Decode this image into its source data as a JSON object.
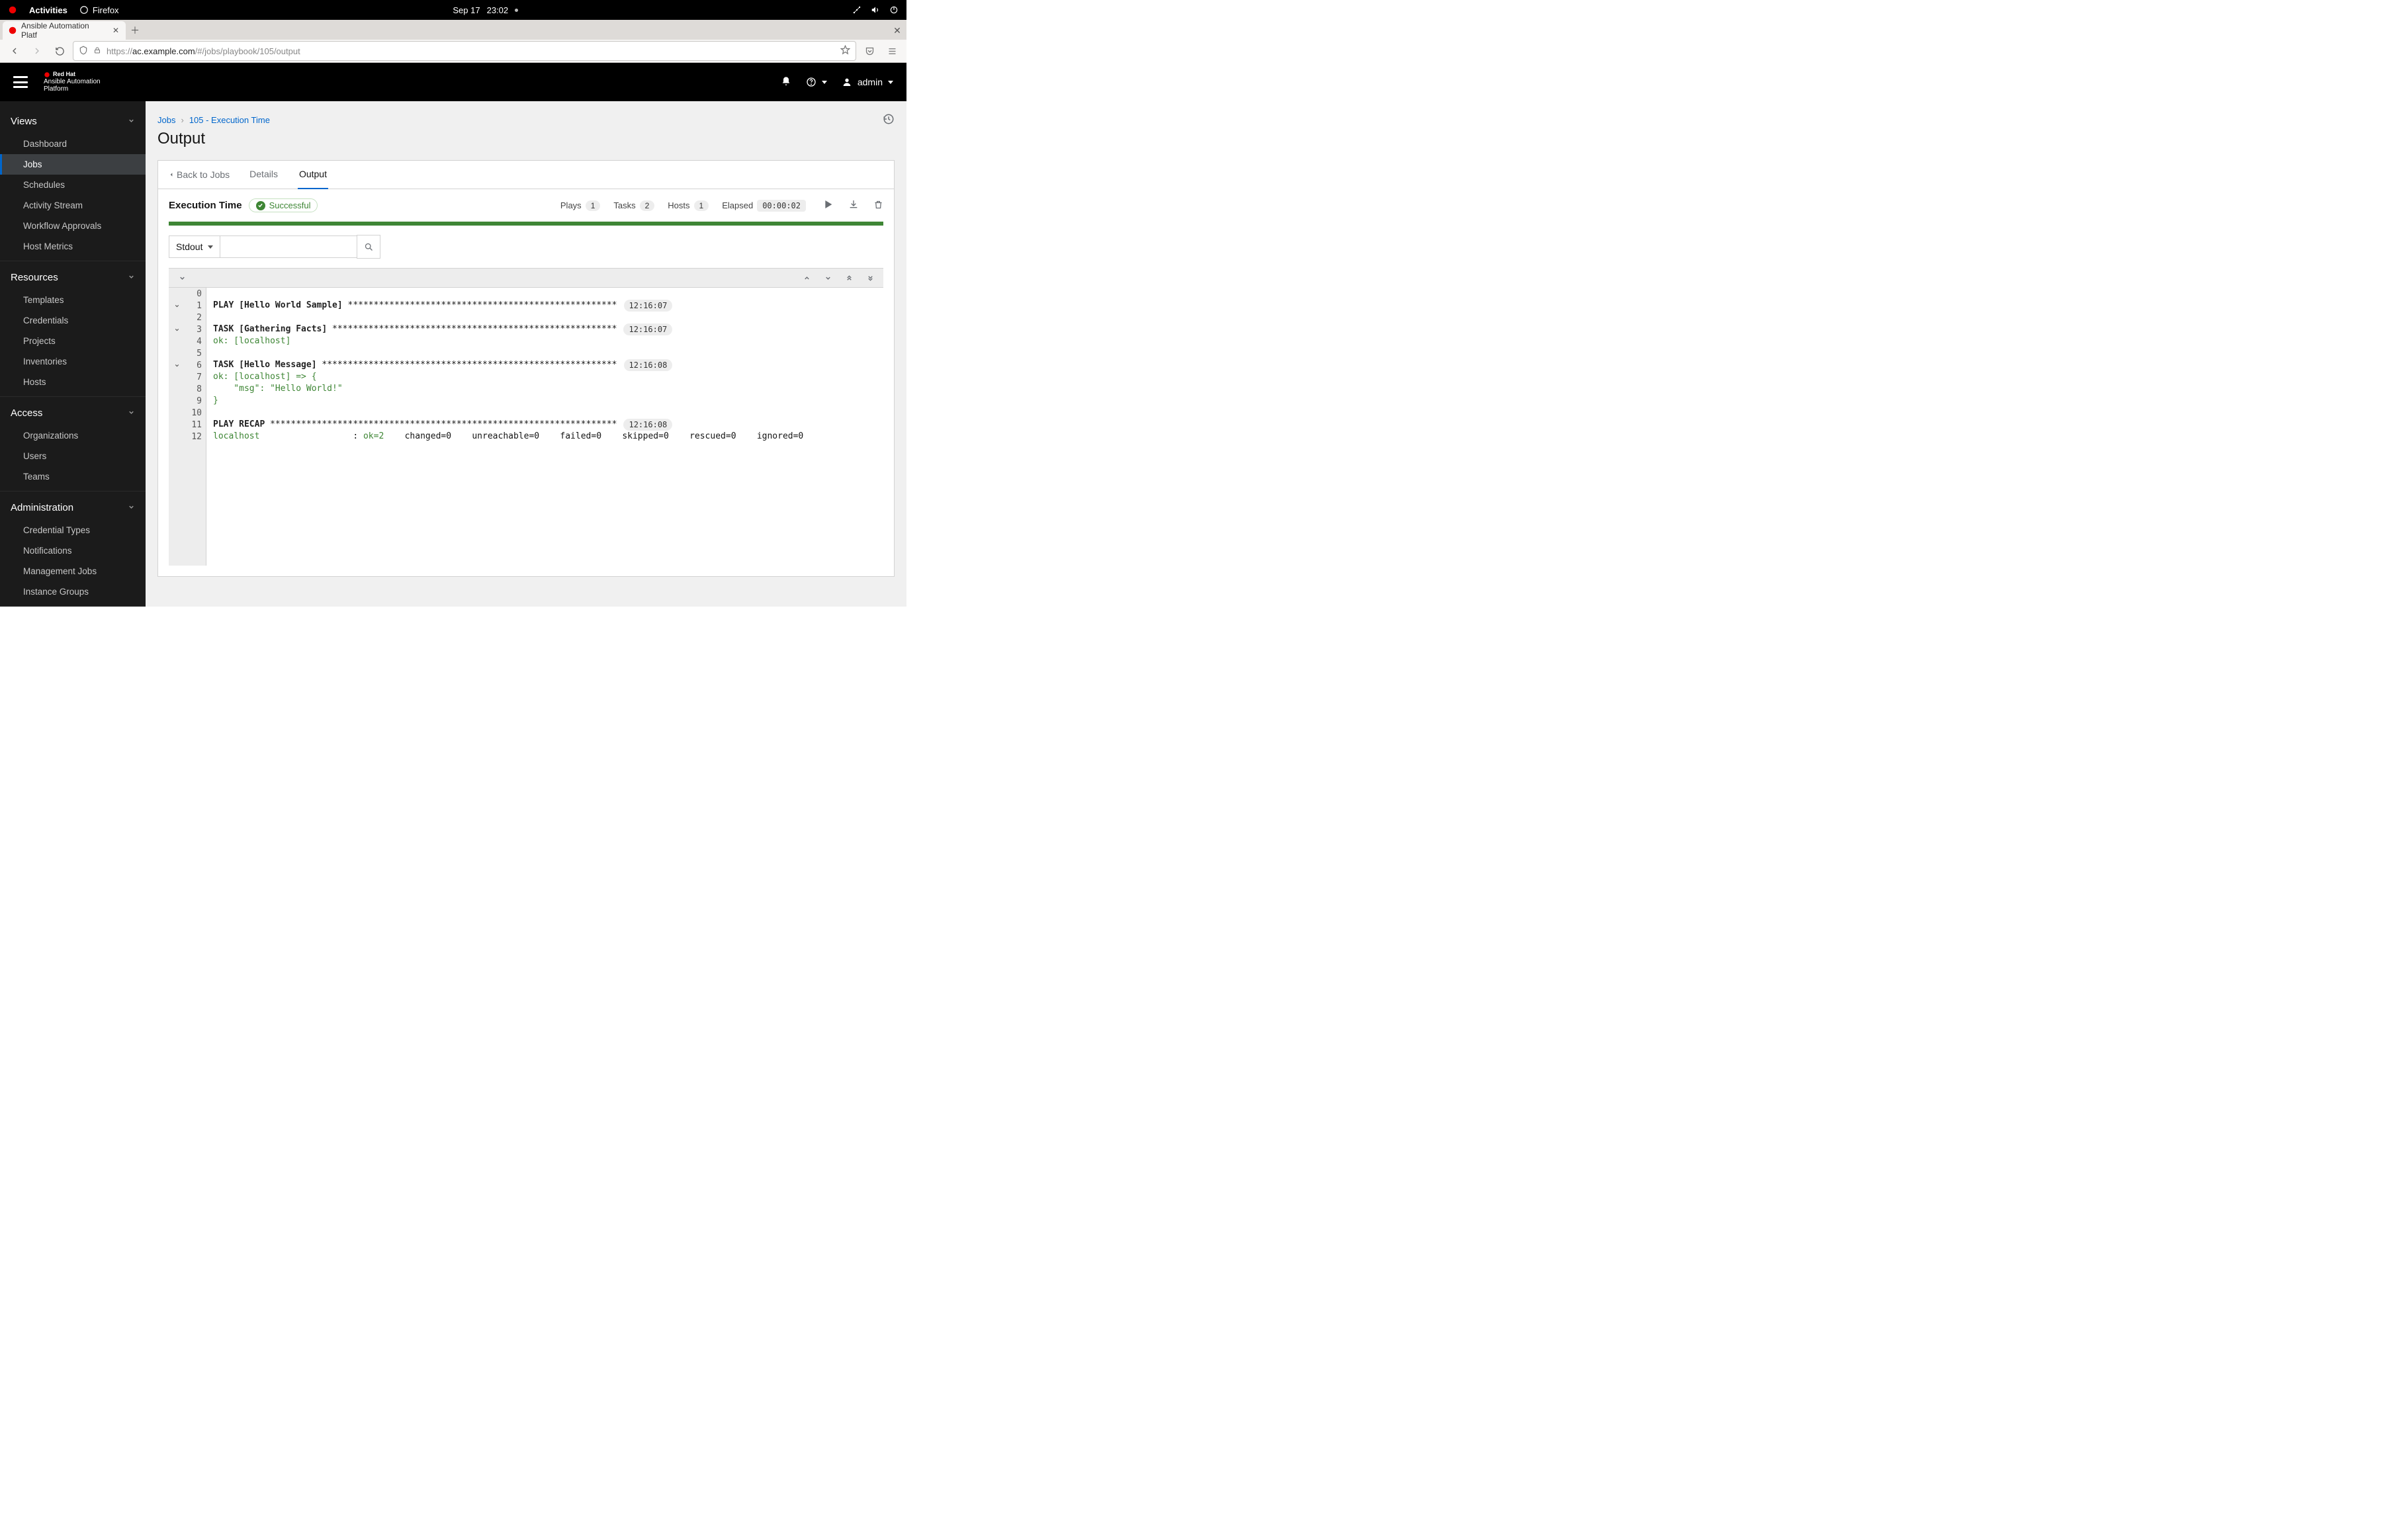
{
  "gnome": {
    "activities": "Activities",
    "app": "Firefox",
    "date": "Sep 17",
    "time": "23:02"
  },
  "browser": {
    "tab_title": "Ansible Automation Platf",
    "url_proto": "https://",
    "url_host": "ac.example.com",
    "url_path": "/#/jobs/playbook/105/output"
  },
  "topbar": {
    "vendor": "Red Hat",
    "product1": "Ansible Automation",
    "product2": "Platform",
    "user": "admin"
  },
  "sidebar": {
    "sections": [
      {
        "title": "Views",
        "items": [
          "Dashboard",
          "Jobs",
          "Schedules",
          "Activity Stream",
          "Workflow Approvals",
          "Host Metrics"
        ],
        "active": 1
      },
      {
        "title": "Resources",
        "items": [
          "Templates",
          "Credentials",
          "Projects",
          "Inventories",
          "Hosts"
        ]
      },
      {
        "title": "Access",
        "items": [
          "Organizations",
          "Users",
          "Teams"
        ]
      },
      {
        "title": "Administration",
        "items": [
          "Credential Types",
          "Notifications",
          "Management Jobs",
          "Instance Groups"
        ]
      }
    ]
  },
  "page": {
    "crumb1": "Jobs",
    "crumb2": "105 - Execution Time",
    "title": "Output",
    "tabs": {
      "back": "Back to Jobs",
      "details": "Details",
      "output": "Output"
    },
    "jobname": "Execution Time",
    "status": "Successful",
    "stats": {
      "plays_label": "Plays",
      "plays": "1",
      "tasks_label": "Tasks",
      "tasks": "2",
      "hosts_label": "Hosts",
      "hosts": "1",
      "elapsed_label": "Elapsed",
      "elapsed": "00:00:02"
    },
    "dropdown": "Stdout"
  },
  "console": {
    "lines": [
      {
        "n": "0",
        "chev": false,
        "segs": []
      },
      {
        "n": "1",
        "chev": true,
        "segs": [
          {
            "t": "PLAY [Hello World Sample] ",
            "c": "hdr"
          },
          {
            "t": "****************************************************",
            "c": ""
          }
        ],
        "time": "12:16:07"
      },
      {
        "n": "2",
        "chev": false,
        "segs": []
      },
      {
        "n": "3",
        "chev": true,
        "segs": [
          {
            "t": "TASK [Gathering Facts] ",
            "c": "hdr"
          },
          {
            "t": "*******************************************************",
            "c": ""
          }
        ],
        "time": "12:16:07"
      },
      {
        "n": "4",
        "chev": false,
        "segs": [
          {
            "t": "ok: [localhost]",
            "c": "green"
          }
        ]
      },
      {
        "n": "5",
        "chev": false,
        "segs": []
      },
      {
        "n": "6",
        "chev": true,
        "segs": [
          {
            "t": "TASK [Hello Message] ",
            "c": "hdr"
          },
          {
            "t": "*********************************************************",
            "c": ""
          }
        ],
        "time": "12:16:08"
      },
      {
        "n": "7",
        "chev": false,
        "segs": [
          {
            "t": "ok: [localhost] => {",
            "c": "green"
          }
        ]
      },
      {
        "n": "8",
        "chev": false,
        "segs": [
          {
            "t": "    \"msg\": \"Hello World!\"",
            "c": "green"
          }
        ]
      },
      {
        "n": "9",
        "chev": false,
        "segs": [
          {
            "t": "}",
            "c": "green"
          }
        ]
      },
      {
        "n": "10",
        "chev": false,
        "segs": []
      },
      {
        "n": "11",
        "chev": false,
        "segs": [
          {
            "t": "PLAY RECAP ",
            "c": "hdr"
          },
          {
            "t": "*******************************************************************",
            "c": ""
          }
        ],
        "time": "12:16:08"
      },
      {
        "n": "12",
        "chev": false,
        "segs": [
          {
            "t": "localhost                  ",
            "c": "green"
          },
          {
            "t": ": ",
            "c": ""
          },
          {
            "t": "ok=2   ",
            "c": "green"
          },
          {
            "t": " changed=0    unreachable=0    failed=0    skipped=0    rescued=0    ignored=0",
            "c": ""
          }
        ]
      }
    ]
  }
}
